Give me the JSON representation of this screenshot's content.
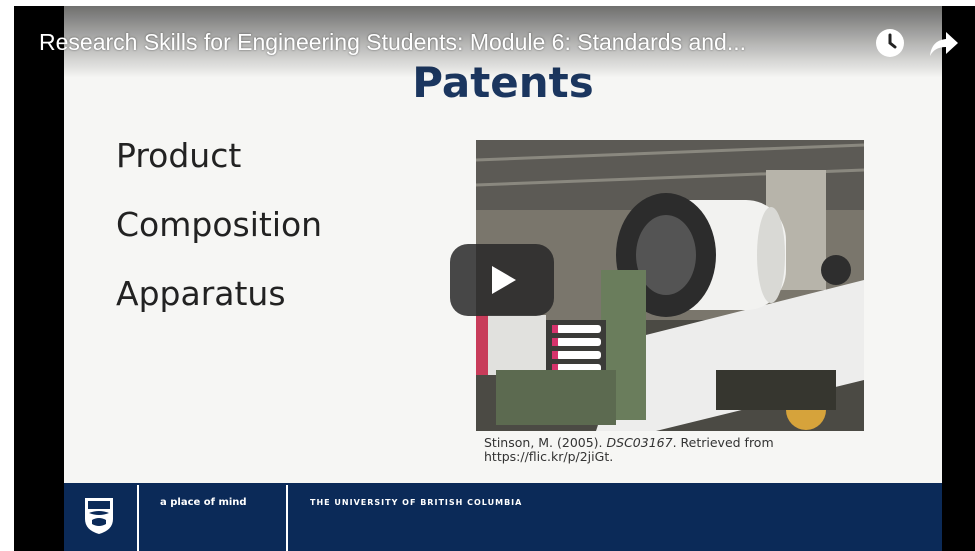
{
  "video": {
    "title": "Research Skills for Engineering Students: Module 6: Standards and...",
    "watch_later_icon": "clock-icon",
    "share_icon": "share-arrow-icon",
    "play_icon": "play-icon"
  },
  "slide": {
    "title": "Patents",
    "bullets": [
      "Product",
      "Composition",
      "Apparatus"
    ],
    "photo": "loom-machine-photo",
    "caption": {
      "author": "Stinson, M. (2005). ",
      "work": "DSC03167",
      "rest": ". Retrieved from",
      "url": "https://flic.kr/p/2jiGt."
    }
  },
  "footer": {
    "motto": "a place of mind",
    "university": "THE UNIVERSITY OF BRITISH COLUMBIA",
    "logo_icon": "ubc-crest-logo"
  },
  "colors": {
    "title": "#1b365f",
    "footer_bg": "#0b2a58",
    "play_button": "#282828"
  }
}
